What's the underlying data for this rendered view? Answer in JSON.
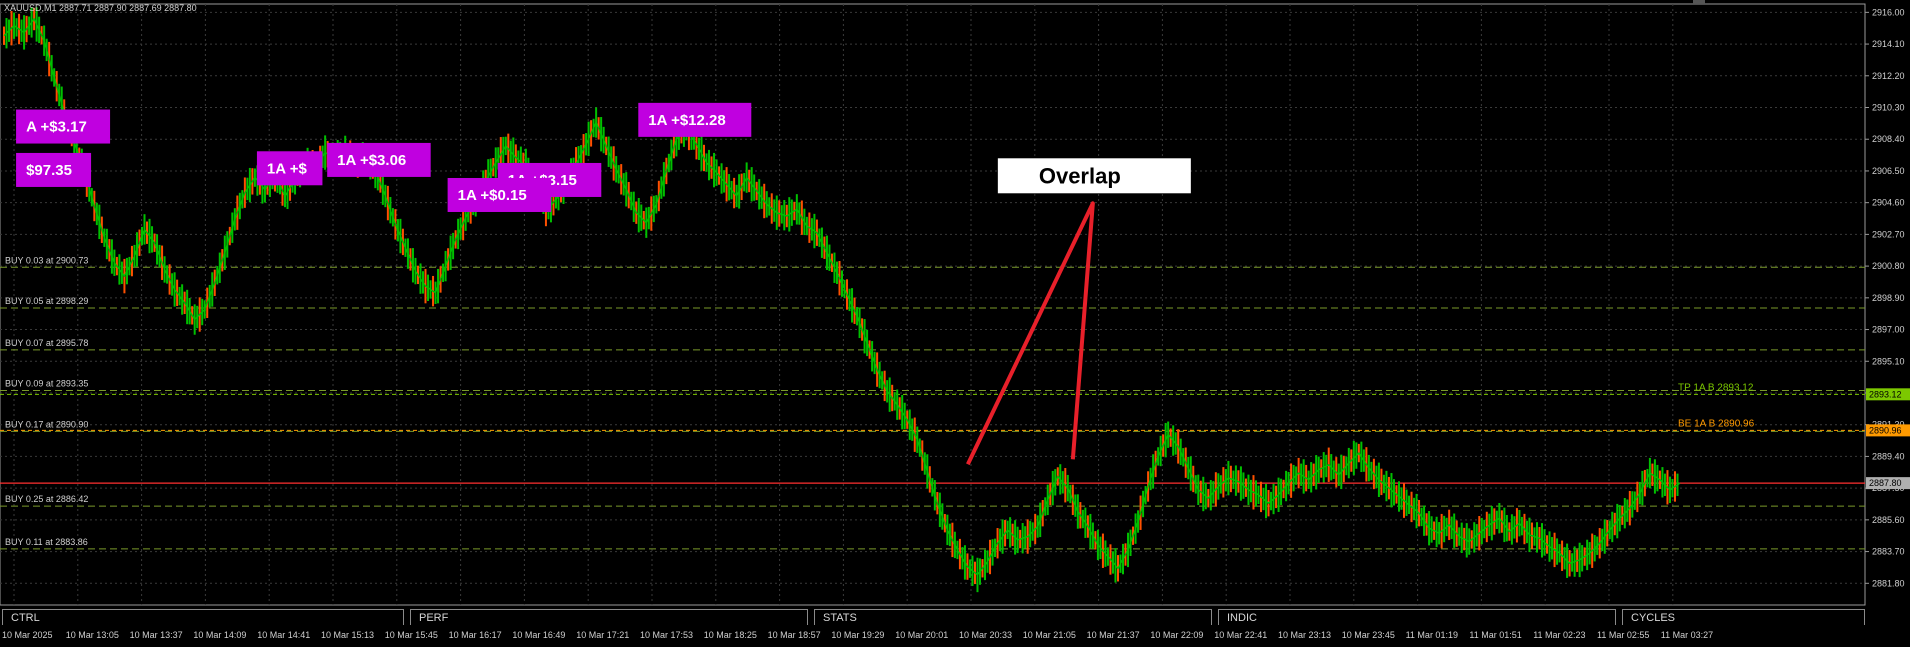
{
  "symbol_text": "XAUUSD,M1  2887.71 2887.90 2887.69 2887.80",
  "tabs": [
    "CTRL",
    "PERF",
    "STATS",
    "INDIC",
    "CYCLES"
  ],
  "colors": {
    "background": "#000000",
    "grid": "#3a3a3a",
    "candle_up": "#00c000",
    "candle_down": "#ff5000",
    "buy_level": "#7a9a2a",
    "tp_level": "#7cc800",
    "be_level": "#ff9a00",
    "current_price": "#ff3030",
    "trade_label": "#c000e0",
    "annotation_arrow": "#e8202a"
  },
  "chart_data": {
    "type": "line",
    "title": "XAUUSD,M1  2887.71 2887.90 2887.69 2887.80",
    "ylim": [
      2880.5,
      2916.5
    ],
    "y_ticks": [
      "2916.00",
      "2914.10",
      "2912.20",
      "2910.30",
      "2908.40",
      "2906.50",
      "2904.60",
      "2902.70",
      "2900.80",
      "2898.90",
      "2897.00",
      "2895.10",
      "2893.20",
      "2891.30",
      "2889.40",
      "2887.50",
      "2885.60",
      "2883.70",
      "2881.80"
    ],
    "x_ticks": [
      "10 Mar 2025",
      "10 Mar 13:05",
      "10 Mar 13:37",
      "10 Mar 14:09",
      "10 Mar 14:41",
      "10 Mar 15:13",
      "10 Mar 15:45",
      "10 Mar 16:17",
      "10 Mar 16:49",
      "10 Mar 17:21",
      "10 Mar 17:53",
      "10 Mar 18:25",
      "10 Mar 18:57",
      "10 Mar 19:29",
      "10 Mar 20:01",
      "10 Mar 20:33",
      "10 Mar 21:05",
      "10 Mar 21:37",
      "10 Mar 22:09",
      "10 Mar 22:41",
      "10 Mar 23:13",
      "10 Mar 23:45",
      "11 Mar 01:19",
      "11 Mar 01:51",
      "11 Mar 02:23",
      "11 Mar 02:55",
      "11 Mar 03:27"
    ],
    "grid": true,
    "series": [
      {
        "x": [
          0,
          1,
          2,
          3,
          4,
          5,
          6,
          7,
          8,
          9,
          10,
          11,
          12,
          13,
          14,
          15,
          16,
          17,
          18,
          19,
          20,
          21,
          22,
          23,
          24,
          25,
          26,
          27,
          28,
          29,
          30,
          31,
          32,
          33,
          34,
          35,
          36,
          37,
          38,
          39,
          40,
          41,
          42,
          43,
          44,
          45,
          46,
          47,
          48,
          49,
          50,
          51,
          52,
          53,
          54,
          55,
          56,
          57,
          58,
          59,
          60,
          61,
          62,
          63,
          64,
          65,
          66,
          67,
          68,
          69,
          70,
          71,
          72,
          73,
          74,
          75,
          76,
          77,
          78,
          79,
          80,
          81,
          82,
          83,
          84,
          85,
          86,
          87,
          88,
          89,
          90,
          91,
          92,
          93,
          94,
          95,
          96,
          97,
          98,
          99,
          100,
          101,
          102,
          103,
          104,
          105,
          106,
          107,
          108,
          109,
          110,
          111,
          112,
          113,
          114,
          115,
          116,
          117,
          118,
          119,
          120,
          121,
          122,
          123,
          124,
          125,
          126,
          127,
          128,
          129,
          130,
          131,
          132,
          133,
          134,
          135,
          136,
          137,
          138,
          139,
          140,
          141,
          142,
          143,
          144,
          145,
          146,
          147,
          148,
          149,
          150,
          151,
          152,
          153,
          154,
          155,
          156,
          157,
          158,
          159,
          160,
          161,
          162,
          163,
          164,
          165,
          166,
          167
        ],
        "values": [
          2914.6,
          2915.2,
          2914.8,
          2915.6,
          2914.3,
          2912.1,
          2910.0,
          2908.2,
          2906.5,
          2904.4,
          2902.5,
          2901.0,
          2900.2,
          2901.4,
          2903.0,
          2902.2,
          2900.6,
          2899.4,
          2898.6,
          2897.6,
          2898.2,
          2899.8,
          2901.6,
          2903.6,
          2905.2,
          2906.1,
          2905.4,
          2906.3,
          2905.0,
          2906.0,
          2907.1,
          2906.6,
          2907.6,
          2907.2,
          2907.7,
          2906.9,
          2907.3,
          2906.5,
          2905.0,
          2903.3,
          2901.9,
          2900.5,
          2899.6,
          2899.2,
          2900.8,
          2902.4,
          2903.7,
          2904.8,
          2905.9,
          2907.0,
          2908.0,
          2907.3,
          2906.8,
          2905.6,
          2904.1,
          2904.8,
          2905.8,
          2906.9,
          2908.1,
          2909.4,
          2908.0,
          2906.6,
          2905.4,
          2904.0,
          2903.4,
          2904.5,
          2906.5,
          2908.4,
          2909.0,
          2908.1,
          2907.0,
          2906.4,
          2905.7,
          2905.0,
          2906.1,
          2905.3,
          2904.5,
          2904.0,
          2903.8,
          2904.2,
          2903.2,
          2902.8,
          2901.6,
          2900.4,
          2899.1,
          2897.8,
          2896.2,
          2894.6,
          2893.3,
          2892.5,
          2891.6,
          2890.4,
          2888.5,
          2886.6,
          2885.0,
          2883.8,
          2882.8,
          2882.3,
          2883.1,
          2884.2,
          2885.0,
          2884.4,
          2884.6,
          2885.2,
          2886.8,
          2888.2,
          2887.5,
          2886.1,
          2885.2,
          2884.1,
          2883.4,
          2882.7,
          2883.8,
          2885.5,
          2887.6,
          2889.4,
          2890.7,
          2890.0,
          2888.7,
          2887.4,
          2886.9,
          2887.6,
          2888.1,
          2887.9,
          2887.4,
          2887.1,
          2886.6,
          2887.1,
          2887.8,
          2888.4,
          2888.0,
          2888.6,
          2888.9,
          2888.3,
          2889.0,
          2889.6,
          2888.7,
          2888.0,
          2887.5,
          2887.0,
          2886.5,
          2886.0,
          2885.1,
          2884.8,
          2885.3,
          2884.6,
          2884.3,
          2884.8,
          2885.3,
          2885.7,
          2884.9,
          2885.4,
          2884.7,
          2884.5,
          2884.0,
          2883.6,
          2883.0,
          2883.2,
          2883.6,
          2884.2,
          2885.0,
          2885.7,
          2886.3,
          2887.2,
          2888.4,
          2888.0,
          2887.4,
          2887.8
        ]
      }
    ],
    "horizontal_lines": [
      {
        "label": "BUY 0.03 at 2900.73",
        "price": 2900.73
      },
      {
        "label": "BUY 0.05 at 2898.29",
        "price": 2898.29
      },
      {
        "label": "BUY 0.07 at 2895.78",
        "price": 2895.78
      },
      {
        "label": "BUY 0.09 at 2893.35",
        "price": 2893.35
      },
      {
        "label": "BUY 0.17 at 2890.90",
        "price": 2890.9
      },
      {
        "label": "BUY 0.25 at 2886.42",
        "price": 2886.42
      },
      {
        "label": "BUY 0.11 at 2883.86",
        "price": 2883.86
      }
    ],
    "tp_line": {
      "label": "TP 1A B 2893.12",
      "price": 2893.12,
      "tag": "2893.12"
    },
    "be_line": {
      "label": "BE 1A B 2890.96",
      "price": 2890.96,
      "tag": "2890.96"
    },
    "current_price": {
      "price": 2887.8,
      "tag": "2887.80"
    },
    "trade_labels": [
      {
        "text": "A +$3.17",
        "x": 2.0,
        "y": 2909.1
      },
      {
        "text": "$97.35",
        "x": 2.0,
        "y": 2906.5
      },
      {
        "text": "1A +$3.06",
        "x": 33.0,
        "y": 2907.1
      },
      {
        "text": "1A +$",
        "x": 26.0,
        "y": 2906.6
      },
      {
        "text": "1A +$3.15",
        "x": 50.0,
        "y": 2905.9
      },
      {
        "text": "1A +$0.15",
        "x": 45.0,
        "y": 2905.0
      },
      {
        "text": "1A +$12.28",
        "x": 64.0,
        "y": 2909.5
      }
    ],
    "annotation": {
      "text": "Overlap",
      "x": 107.0,
      "y": 2906.0
    }
  }
}
